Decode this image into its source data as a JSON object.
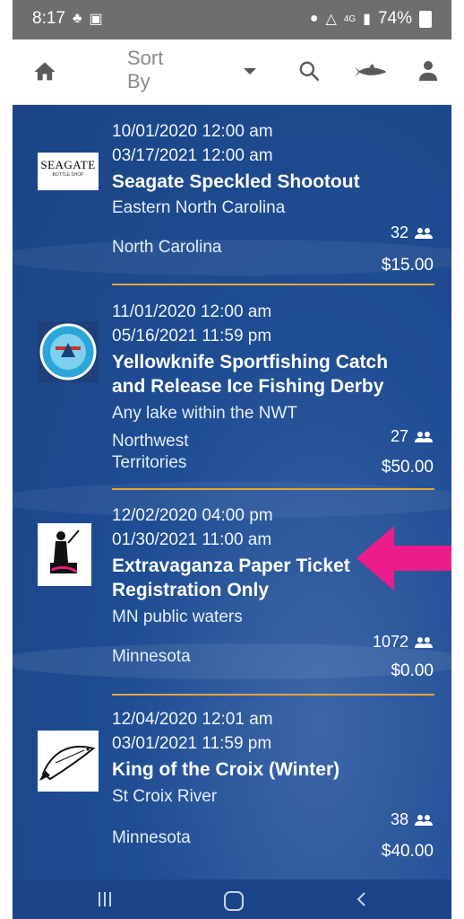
{
  "status_bar": {
    "time": "8:17",
    "battery": "74%",
    "network": "4G"
  },
  "app_bar": {
    "sort_label": "Sort By",
    "sort_line1": "Sort",
    "sort_line2": "By"
  },
  "tournaments": [
    {
      "start": "10/01/2020 12:00 am",
      "end": "03/17/2021 12:00 am",
      "title": "Seagate Speckled Shootout",
      "title_line1": "Seagate Speckled Shootout",
      "title_line2": "",
      "location": "Eastern North Carolina",
      "region": "North Carolina",
      "region_line1": "North Carolina",
      "region_line2": "",
      "participants": "32",
      "fee": "$15.00",
      "logo_text": "SEAGATE",
      "logo_subtext": "BOTTLE SHOP"
    },
    {
      "start": "11/01/2020 12:00 am",
      "end": "05/16/2021 11:59 pm",
      "title": "Yellowknife Sportfishing Catch and Release Ice Fishing Derby",
      "title_line1": "Yellowknife Sportfishing Catch",
      "title_line2": "and Release Ice Fishing Derby",
      "location": "Any lake within the NWT",
      "region": "Northwest Territories",
      "region_line1": "Northwest",
      "region_line2": "Territories",
      "participants": "27",
      "fee": "$50.00"
    },
    {
      "start": "12/02/2020 04:00 pm",
      "end": "01/30/2021 11:00 am",
      "title": "Extravaganza Paper Ticket Registration Only",
      "title_line1": "Extravaganza Paper Ticket",
      "title_line2": "Registration Only",
      "location": "MN public waters",
      "region": "Minnesota",
      "region_line1": "Minnesota",
      "region_line2": "",
      "participants": "1072",
      "fee": "$0.00"
    },
    {
      "start": "12/04/2020 12:01 am",
      "end": "03/01/2021 11:59 pm",
      "title": "King of the Croix (Winter)",
      "title_line1": "King of the Croix (Winter)",
      "title_line2": "",
      "location": "St Croix River",
      "region": "Minnesota",
      "region_line1": "Minnesota",
      "region_line2": "",
      "participants": "38",
      "fee": "$40.00"
    }
  ],
  "colors": {
    "list_background": "#1f4d93",
    "divider": "#e8a33a",
    "annotation_arrow": "#ec1c8c",
    "status_bar": "#6e6e6e"
  },
  "icons": {
    "app_bar": [
      "home-icon",
      "sort-caret-icon",
      "search-icon",
      "fish-icon",
      "person-icon"
    ],
    "participants": "people-icon",
    "nav": [
      "recent-apps-icon",
      "home-nav-icon",
      "back-icon"
    ]
  }
}
